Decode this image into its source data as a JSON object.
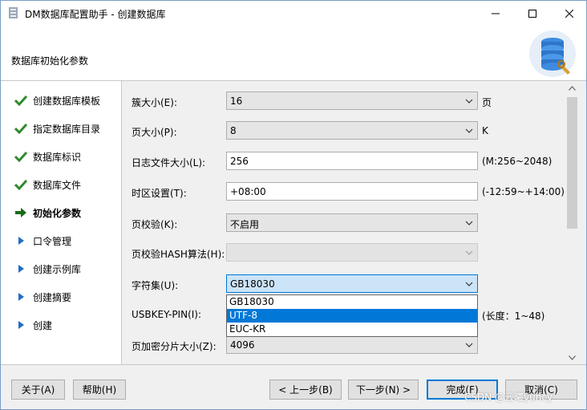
{
  "window": {
    "title": "DM数据库配置助手 - 创建数据库",
    "header_title": "数据库初始化参数"
  },
  "nav": {
    "items": [
      {
        "label": "创建数据库模板",
        "status": "done"
      },
      {
        "label": "指定数据库目录",
        "status": "done"
      },
      {
        "label": "数据库标识",
        "status": "done"
      },
      {
        "label": "数据库文件",
        "status": "done"
      },
      {
        "label": "初始化参数",
        "status": "current"
      },
      {
        "label": "口令管理",
        "status": "pending"
      },
      {
        "label": "创建示例库",
        "status": "pending"
      },
      {
        "label": "创建摘要",
        "status": "pending"
      },
      {
        "label": "创建",
        "status": "pending"
      }
    ]
  },
  "form": {
    "extent_size": {
      "label": "簇大小(E):",
      "value": "16",
      "suffix": "页"
    },
    "page_size": {
      "label": "页大小(P):",
      "value": "8",
      "suffix": "K"
    },
    "log_size": {
      "label": "日志文件大小(L):",
      "value": "256",
      "suffix": "(M:256~2048)"
    },
    "time_zone": {
      "label": "时区设置(T):",
      "value": "+08:00",
      "suffix": "(-12:59~+14:00)"
    },
    "page_check": {
      "label": "页校验(K):",
      "value": "不启用"
    },
    "page_hash": {
      "label": "页校验HASH算法(H):",
      "value": ""
    },
    "charset": {
      "label": "字符集(U):",
      "value": "GB18030",
      "options": [
        "GB18030",
        "UTF-8",
        "EUC-KR"
      ],
      "highlighted": "UTF-8"
    },
    "usbkey_pin": {
      "label": "USBKEY-PIN(I):",
      "suffix": "(长度：1~48)"
    },
    "page_enc_size": {
      "label": "页加密分片大小(Z):",
      "value": "4096"
    }
  },
  "footer": {
    "about": "关于(A)",
    "help": "帮助(H)",
    "prev": "< 上一步(B)",
    "next": "下一步(N) >",
    "finish": "完成(F)",
    "cancel": "取消(C)",
    "watermark": "CSDN @云曦yuncy"
  },
  "colors": {
    "accent": "#0078d7",
    "check": "#2e8b2e",
    "arrow_pending": "#1f6fc5"
  }
}
